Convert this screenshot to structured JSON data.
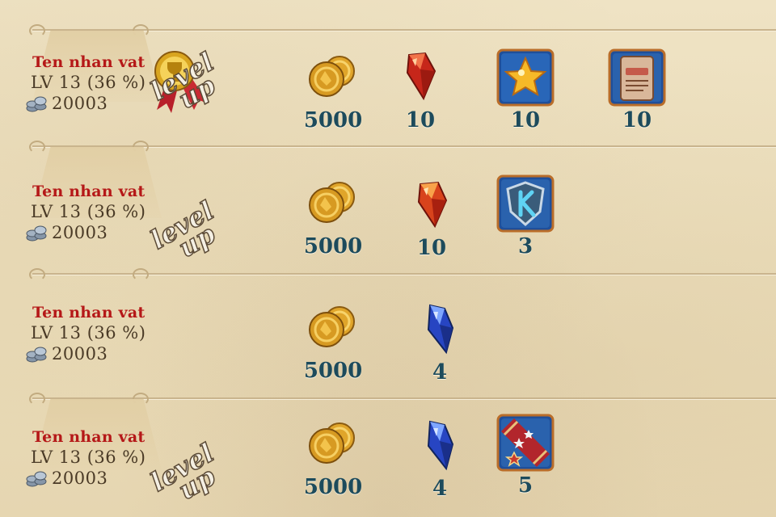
{
  "rows": [
    {
      "name": "Ten nhan vat",
      "level": "LV 13 (36 %)",
      "money": "20003",
      "levelup": [
        "level",
        "up"
      ],
      "medal": true,
      "rewards": [
        {
          "icon": "gold-coins-icon",
          "qty": "5000"
        },
        {
          "icon": "red-gem-icon",
          "qty": "10"
        },
        {
          "icon": "gold-star-icon",
          "qty": "10"
        },
        {
          "icon": "passed-scroll-icon",
          "qty": "10"
        }
      ]
    },
    {
      "name": "Ten nhan vat",
      "level": "LV 13 (36 %)",
      "money": "20003",
      "levelup": [
        "level",
        "up"
      ],
      "medal": false,
      "rewards": [
        {
          "icon": "gold-coins-icon",
          "qty": "5000"
        },
        {
          "icon": "red-gem-icon",
          "qty": "10"
        },
        {
          "icon": "k-shield-icon",
          "qty": "3"
        }
      ]
    },
    {
      "name": "Ten nhan vat",
      "level": "LV 13 (36 %)",
      "money": "20003",
      "levelup": null,
      "medal": false,
      "rewards": [
        {
          "icon": "gold-coins-icon",
          "qty": "5000"
        },
        {
          "icon": "blue-gem-icon",
          "qty": "4"
        }
      ]
    },
    {
      "name": "Ten nhan vat",
      "level": "LV 13 (36 %)",
      "money": "20003",
      "levelup": [
        "level",
        "up"
      ],
      "medal": false,
      "rewards": [
        {
          "icon": "gold-coins-icon",
          "qty": "5000"
        },
        {
          "icon": "blue-gem-icon",
          "qty": "4"
        },
        {
          "icon": "star-rank-badge-icon",
          "qty": "5"
        }
      ]
    }
  ],
  "colors": {
    "name": "#b51818",
    "qty": "#1d4b5c",
    "paper": "#eadcb9"
  }
}
